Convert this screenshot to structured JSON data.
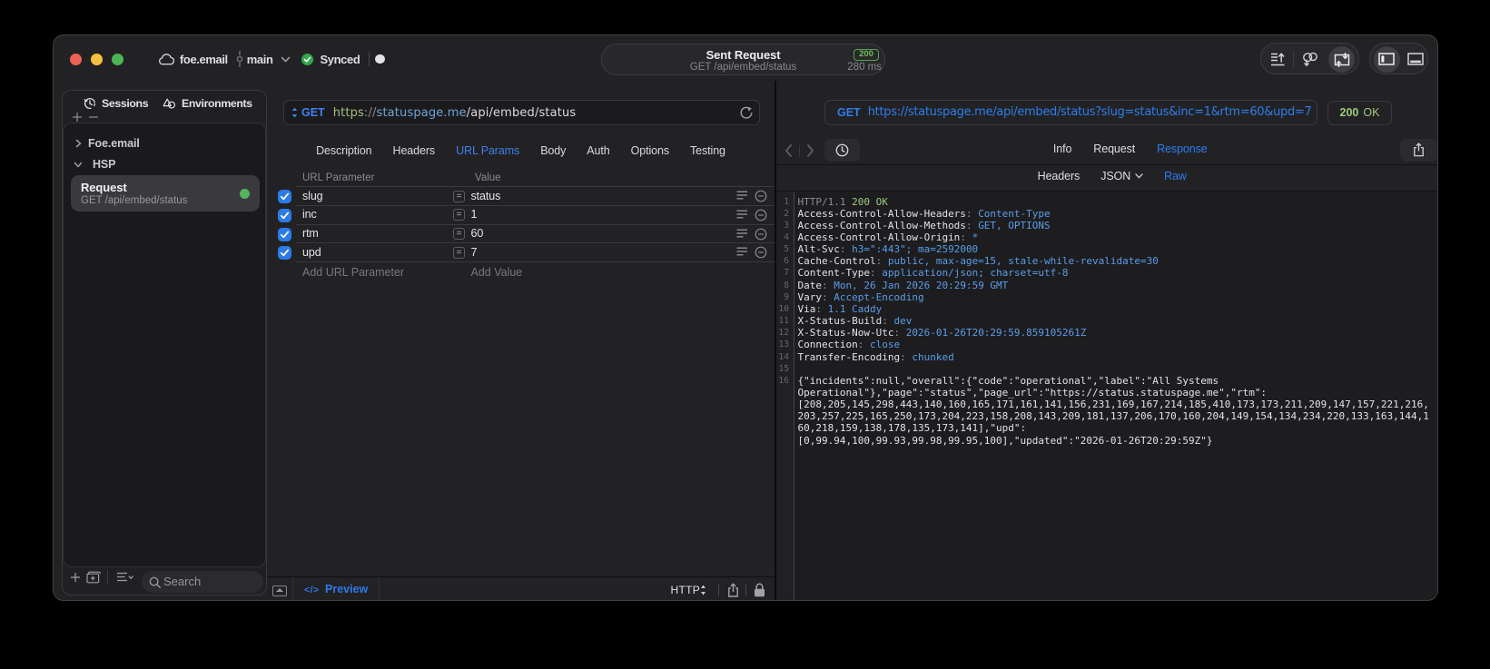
{
  "titlebar": {
    "project": "foe.email",
    "branch": "main",
    "sync_status": "Synced",
    "sent_pill": {
      "title": "Sent Request",
      "subtitle": "GET /api/embed/status",
      "status_code": "200",
      "duration": "280 ms"
    }
  },
  "sidebar": {
    "tabs": [
      {
        "label": "Sessions"
      },
      {
        "label": "Environments"
      }
    ],
    "tree_items": [
      {
        "label": "Foe.email",
        "expanded": false
      },
      {
        "label": "HSP",
        "expanded": true
      }
    ],
    "request_item": {
      "title": "Request",
      "subtitle": "GET /api/embed/status"
    },
    "search_placeholder": "Search"
  },
  "request_editor": {
    "method": "GET",
    "url": {
      "scheme": "https",
      "sep": "://",
      "host": "statuspage.me",
      "path": "/api/embed/status"
    },
    "tabs": [
      "Description",
      "Headers",
      "URL Params",
      "Body",
      "Auth",
      "Options",
      "Testing"
    ],
    "active_tab": "URL Params",
    "param_table": {
      "columns": [
        "URL Parameter",
        "Value"
      ],
      "rows": [
        {
          "name": "slug",
          "value": "status",
          "enabled": true
        },
        {
          "name": "inc",
          "value": "1",
          "enabled": true
        },
        {
          "name": "rtm",
          "value": "60",
          "enabled": true
        },
        {
          "name": "upd",
          "value": "7",
          "enabled": true
        }
      ],
      "add_name_label": "Add URL Parameter",
      "add_value_label": "Add Value"
    },
    "footer": {
      "code_glyph": "</>",
      "preview_label": "Preview",
      "protocol": "HTTP"
    }
  },
  "exchange_viewer": {
    "method": "GET",
    "url": "https://statuspage.me/api/embed/status?slug=status&inc=1&rtm=60&upd=7",
    "status_code": "200",
    "status_reason": "OK",
    "tabs": [
      "Info",
      "Request",
      "Response"
    ],
    "active_tab": "Response",
    "subtabs": [
      "Headers",
      "JSON",
      "Raw"
    ],
    "active_subtab": "Raw",
    "response_lines": [
      {
        "n": "1",
        "parts": [
          [
            "g",
            "HTTP/1.1 "
          ],
          [
            "gr",
            "200 OK"
          ]
        ]
      },
      {
        "n": "2",
        "parts": [
          [
            "w",
            "Access-Control-Allow-Headers"
          ],
          [
            "g",
            ": "
          ],
          [
            "b",
            "Content-Type"
          ]
        ]
      },
      {
        "n": "3",
        "parts": [
          [
            "w",
            "Access-Control-Allow-Methods"
          ],
          [
            "g",
            ": "
          ],
          [
            "b",
            "GET, OPTIONS"
          ]
        ]
      },
      {
        "n": "4",
        "parts": [
          [
            "w",
            "Access-Control-Allow-Origin"
          ],
          [
            "g",
            ": "
          ],
          [
            "b",
            "*"
          ]
        ]
      },
      {
        "n": "5",
        "parts": [
          [
            "w",
            "Alt-Svc"
          ],
          [
            "g",
            ": "
          ],
          [
            "b",
            "h3=\":443\"; ma=2592000"
          ]
        ]
      },
      {
        "n": "6",
        "parts": [
          [
            "w",
            "Cache-Control"
          ],
          [
            "g",
            ": "
          ],
          [
            "b",
            "public, max-age=15, stale-while-revalidate=30"
          ]
        ]
      },
      {
        "n": "7",
        "parts": [
          [
            "w",
            "Content-Type"
          ],
          [
            "g",
            ": "
          ],
          [
            "b",
            "application/json; charset=utf-8"
          ]
        ]
      },
      {
        "n": "8",
        "parts": [
          [
            "w",
            "Date"
          ],
          [
            "g",
            ": "
          ],
          [
            "b",
            "Mon, 26 Jan 2026 20:29:59 GMT"
          ]
        ]
      },
      {
        "n": "9",
        "parts": [
          [
            "w",
            "Vary"
          ],
          [
            "g",
            ": "
          ],
          [
            "b",
            "Accept-Encoding"
          ]
        ]
      },
      {
        "n": "10",
        "parts": [
          [
            "w",
            "Via"
          ],
          [
            "g",
            ": "
          ],
          [
            "b",
            "1.1 Caddy"
          ]
        ]
      },
      {
        "n": "11",
        "parts": [
          [
            "w",
            "X-Status-Build"
          ],
          [
            "g",
            ": "
          ],
          [
            "b",
            "dev"
          ]
        ]
      },
      {
        "n": "12",
        "parts": [
          [
            "w",
            "X-Status-Now-Utc"
          ],
          [
            "g",
            ": "
          ],
          [
            "b",
            "2026-01-26T20:29:59.859105261Z"
          ]
        ]
      },
      {
        "n": "13",
        "parts": [
          [
            "w",
            "Connection"
          ],
          [
            "g",
            ": "
          ],
          [
            "b",
            "close"
          ]
        ]
      },
      {
        "n": "14",
        "parts": [
          [
            "w",
            "Transfer-Encoding"
          ],
          [
            "g",
            ": "
          ],
          [
            "b",
            "chunked"
          ]
        ]
      },
      {
        "n": "15",
        "parts": []
      },
      {
        "n": "16",
        "parts": [
          [
            "w",
            "{\"incidents\":null,\"overall\":{\"code\":\"operational\",\"label\":\"All Systems"
          ]
        ]
      },
      {
        "n": "",
        "parts": [
          [
            "w",
            "Operational\"},\"page\":\"status\",\"page_url\":\"https://status.statuspage.me\",\"rtm\":"
          ]
        ]
      },
      {
        "n": "",
        "parts": [
          [
            "w",
            "[208,205,145,298,443,140,160,165,171,161,141,156,231,169,167,214,185,410,173,173,211,209,147,157,221,216,"
          ]
        ]
      },
      {
        "n": "",
        "parts": [
          [
            "w",
            "203,257,225,165,250,173,204,223,158,208,143,209,181,137,206,170,160,204,149,154,134,234,220,133,163,144,1"
          ]
        ]
      },
      {
        "n": "",
        "parts": [
          [
            "w",
            "60,218,159,138,178,135,173,141],\"upd\":"
          ]
        ]
      },
      {
        "n": "",
        "parts": [
          [
            "w",
            "[0,99.94,100,99.93,99.98,99.95,100],\"updated\":\"2026-01-26T20:29:59Z\"}"
          ]
        ]
      }
    ]
  }
}
